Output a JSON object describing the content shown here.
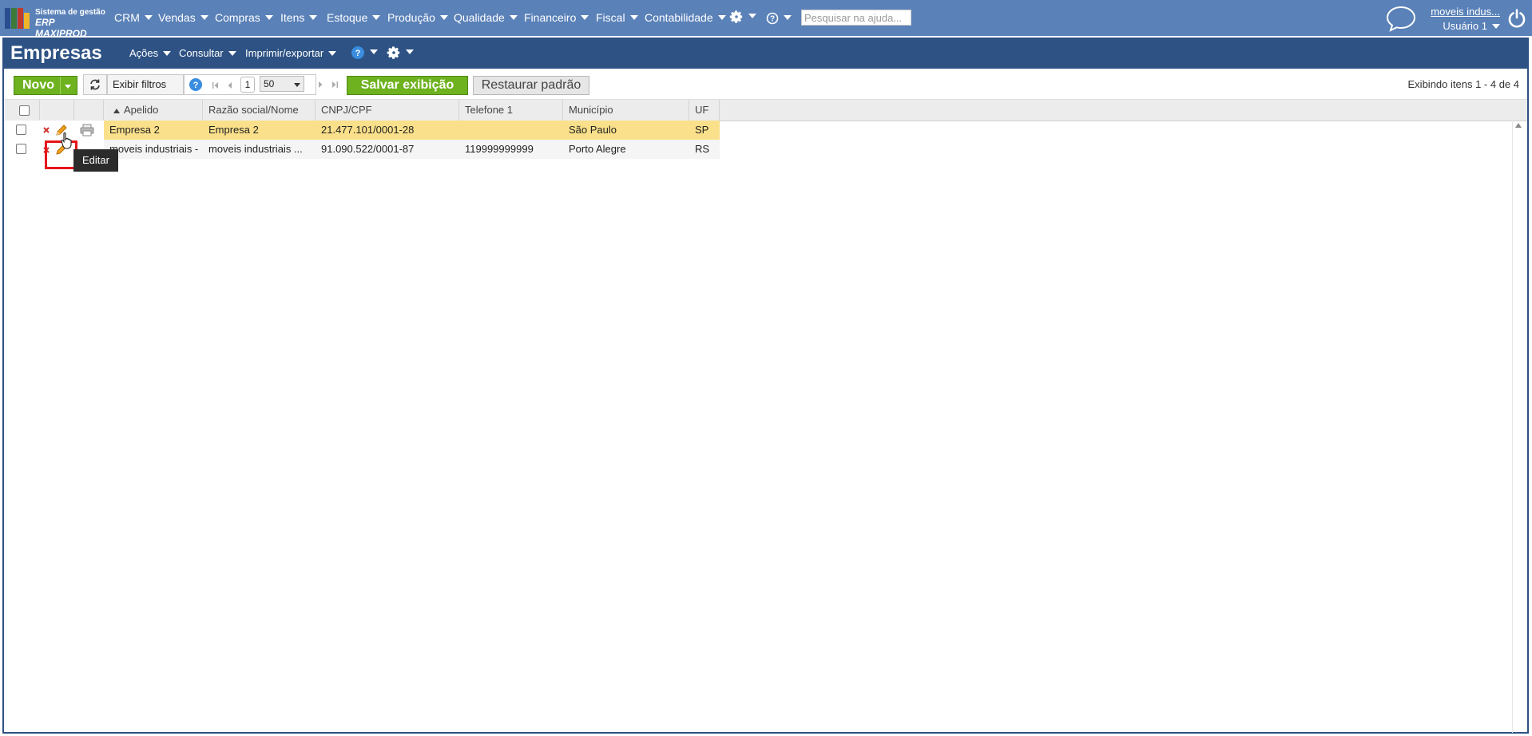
{
  "topnav": {
    "logo_line1": "Sistema de gestão",
    "logo_line2": "ERP MAXIPROD",
    "menus": [
      "CRM",
      "Vendas",
      "Compras",
      "Itens",
      "Estoque",
      "Produção",
      "Qualidade",
      "Financeiro",
      "Fiscal",
      "Contabilidade"
    ],
    "help_search_placeholder": "Pesquisar na ajuda...",
    "company_link": "moveis indus...",
    "user_name": "Usuário 1"
  },
  "page": {
    "title": "Empresas",
    "menus": [
      "Ações",
      "Consultar",
      "Imprimir/exportar"
    ]
  },
  "toolbar": {
    "new_label": "Novo",
    "show_filters_label": "Exibir filtros",
    "page_number": "1",
    "page_size": "50",
    "save_view_label": "Salvar exibição",
    "restore_default_label": "Restaurar padrão",
    "record_count": "Exibindo itens 1 - 4 de 4"
  },
  "grid": {
    "columns": [
      "Apelido",
      "Razão social/Nome",
      "CNPJ/CPF",
      "Telefone 1",
      "Município",
      "UF"
    ],
    "rows": [
      {
        "apelido": "Empresa 2",
        "razao": "Empresa 2",
        "cnpj": "21.477.101/0001-28",
        "telefone": "",
        "municipio": "São Paulo",
        "uf": "SP"
      },
      {
        "apelido": "moveis industriais -",
        "razao": "moveis industriais ...",
        "cnpj": "91.090.522/0001-87",
        "telefone": "119999999999",
        "municipio": "Porto Alegre",
        "uf": "RS"
      }
    ]
  },
  "tooltip": {
    "text": "Editar"
  },
  "colors": {
    "nav_bg": "#5a81b8",
    "header_bg": "#2d5283",
    "green_button": "#6eb21f",
    "selected_row": "#fae08a",
    "highlight_box": "#e8141b"
  }
}
